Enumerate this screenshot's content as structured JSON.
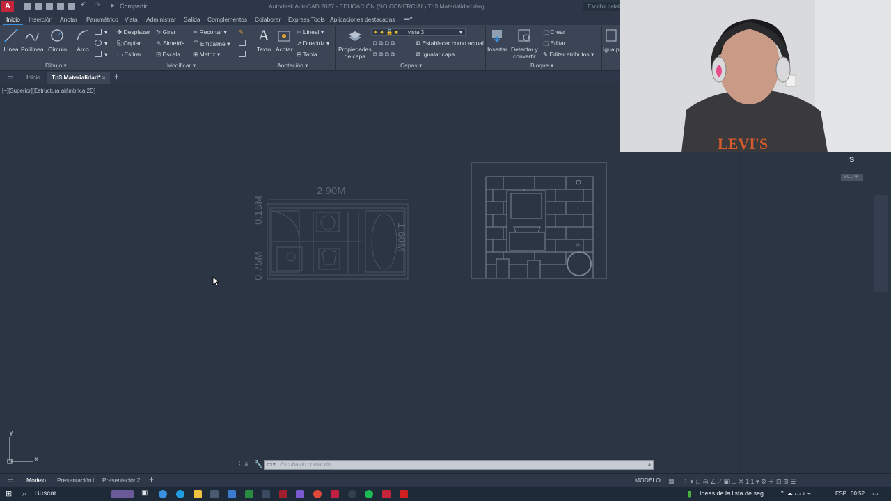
{
  "titlebar": {
    "app_letter": "A",
    "share_label": "Compartir",
    "title": "Autodesk AutoCAD 2027 - EDUCACIÓN (NO COMERCIAL)   Tp3 Materialidad.dwg",
    "search_placeholder": "Escribir palabra"
  },
  "ribbon_tabs": [
    "Inicio",
    "Inserción",
    "Anotar",
    "Paramétrico",
    "Vista",
    "Administrar",
    "Salida",
    "Complementos",
    "Colaborar",
    "Express Tools",
    "Aplicaciones destacadas"
  ],
  "ribbon": {
    "draw": {
      "title": "Dibujo",
      "tools": [
        "Línea",
        "Polilínea",
        "Círculo",
        "Arco"
      ]
    },
    "modify": {
      "title": "Modificar",
      "tools": [
        "Desplazar",
        "Girar",
        "Recortar",
        "Copiar",
        "Simetría",
        "Empalme",
        "Estirar",
        "Escala",
        "Matriz"
      ]
    },
    "annotation": {
      "title": "Anotación",
      "text": "Texto",
      "dimension": "Acotar",
      "small": [
        "Lineal",
        "Directriz",
        "Tabla"
      ]
    },
    "layers": {
      "title": "Capas",
      "properties_line1": "Propiedades",
      "properties_line2": "de capa",
      "current_layer": "vista 3",
      "set_current": "Establecer como actual",
      "match_layer": "Igualar capa"
    },
    "block": {
      "title": "Bloque",
      "insert": "Insertar",
      "detect_line1": "Detectar y",
      "detect_line2": "convertir",
      "create": "Crear",
      "edit": "Editar",
      "edit_attributes": "Editar atributos"
    },
    "properties_partial": "Igua propie"
  },
  "doc_tabs": {
    "start": "Inicio",
    "active": "Tp3 Materialidad*"
  },
  "viewport_label": "[−][Superior][Estructura alámbrica 2D]",
  "drawing": {
    "dim_top": "2.90M",
    "dim_right": "1.60M",
    "dim_left_top": "0.15M",
    "dim_left_bottom": "0.75M"
  },
  "viewcube": {
    "south": "S",
    "wcs": "SCU"
  },
  "command_line": {
    "placeholder": "Escriba un comando"
  },
  "layout_tabs": [
    "Modelo",
    "Presentación1",
    "Presentación2"
  ],
  "status": {
    "model": "MODELO",
    "scale": "1:1"
  },
  "taskbar": {
    "search": "Buscar",
    "news": "Ideas de la lista de seg...",
    "lang": "ESP",
    "time": "00:52"
  },
  "colors": {
    "canvas": "#2b3543",
    "ribbon": "#3b4556",
    "accent": "#3a91e0",
    "autocad_red": "#c4253a"
  }
}
